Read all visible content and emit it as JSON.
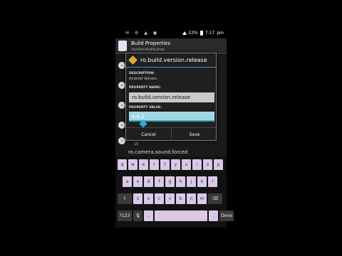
{
  "status_bar": {
    "battery": "23%",
    "time": "7:17",
    "ampm": "pm"
  },
  "app": {
    "title": "Build Properties",
    "path": "/system/build.prop"
  },
  "list": {
    "peek_text": "ro.camera.sound.forced",
    "peek_small": "16"
  },
  "dialog": {
    "title": "ro.build.version.release",
    "description_label": "DESCRIPTION:",
    "description_value": "Android Version",
    "property_name_label": "PROPERTY NAME:",
    "property_name_value": "ro.build.version.release",
    "property_value_label": "PROPERTY VALUE:",
    "property_value_value": "4.4.2",
    "cancel_label": "Cancel",
    "save_label": "Save"
  },
  "keyboard": {
    "row1": [
      "q",
      "w",
      "e",
      "r",
      "t",
      "y",
      "u",
      "i",
      "o",
      "p"
    ],
    "row1_nums": [
      "1",
      "2",
      "3",
      "4",
      "5",
      "6",
      "7",
      "8",
      "9",
      "0"
    ],
    "row2": [
      "a",
      "s",
      "d",
      "f",
      "g",
      "h",
      "j",
      "k",
      "l"
    ],
    "row3": [
      "z",
      "x",
      "c",
      "v",
      "b",
      "n",
      "m"
    ],
    "symbols_label": "?123",
    "comma_label": ",",
    "period_label": ".",
    "done_label": "Done"
  }
}
